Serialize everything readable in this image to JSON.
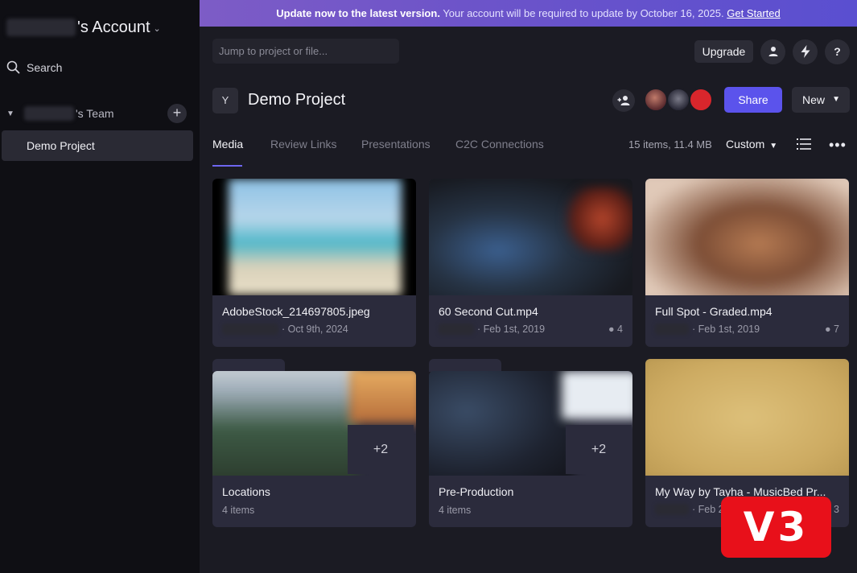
{
  "sidebar": {
    "account_suffix": "'s Account",
    "search_label": "Search",
    "team_suffix": "'s Team",
    "project_item": "Demo Project"
  },
  "banner": {
    "bold_text": "Update now to the latest version.",
    "detail_text": "Your account will be required to update by October 16, 2025.",
    "link_text": "Get Started"
  },
  "header": {
    "jump_placeholder": "Jump to project or file...",
    "upgrade_label": "Upgrade",
    "help_label": "?"
  },
  "project": {
    "avatar_letter": "Y",
    "title": "Demo Project",
    "share_label": "Share",
    "new_label": "New"
  },
  "tabs": [
    {
      "label": "Media"
    },
    {
      "label": "Review Links"
    },
    {
      "label": "Presentations"
    },
    {
      "label": "C2C Connections"
    }
  ],
  "toolbar": {
    "meta": "15 items, 11.4 MB",
    "sort_label": "Custom"
  },
  "cards": [
    {
      "name": "AdobeStock_214697805.jpeg",
      "date": "· Oct 9th, 2024",
      "comments": ""
    },
    {
      "name": "60 Second Cut.mp4",
      "date": "· Feb 1st, 2019",
      "comments": "4"
    },
    {
      "name": "Full Spot - Graded.mp4",
      "date": "· Feb 1st, 2019",
      "comments": "7"
    },
    {
      "name": "Locations",
      "date": "4 items",
      "more": "+2"
    },
    {
      "name": "Pre-Production",
      "date": "4 items",
      "more": "+2"
    },
    {
      "name": "My Way by Tayha - MusicBed Pr...",
      "date": "· Feb 2",
      "comments": "3"
    }
  ],
  "badge": {
    "text": "V3"
  },
  "colors": {
    "accent": "#5b53ec",
    "banner": "#6d54c9",
    "badge": "#e8101a"
  }
}
